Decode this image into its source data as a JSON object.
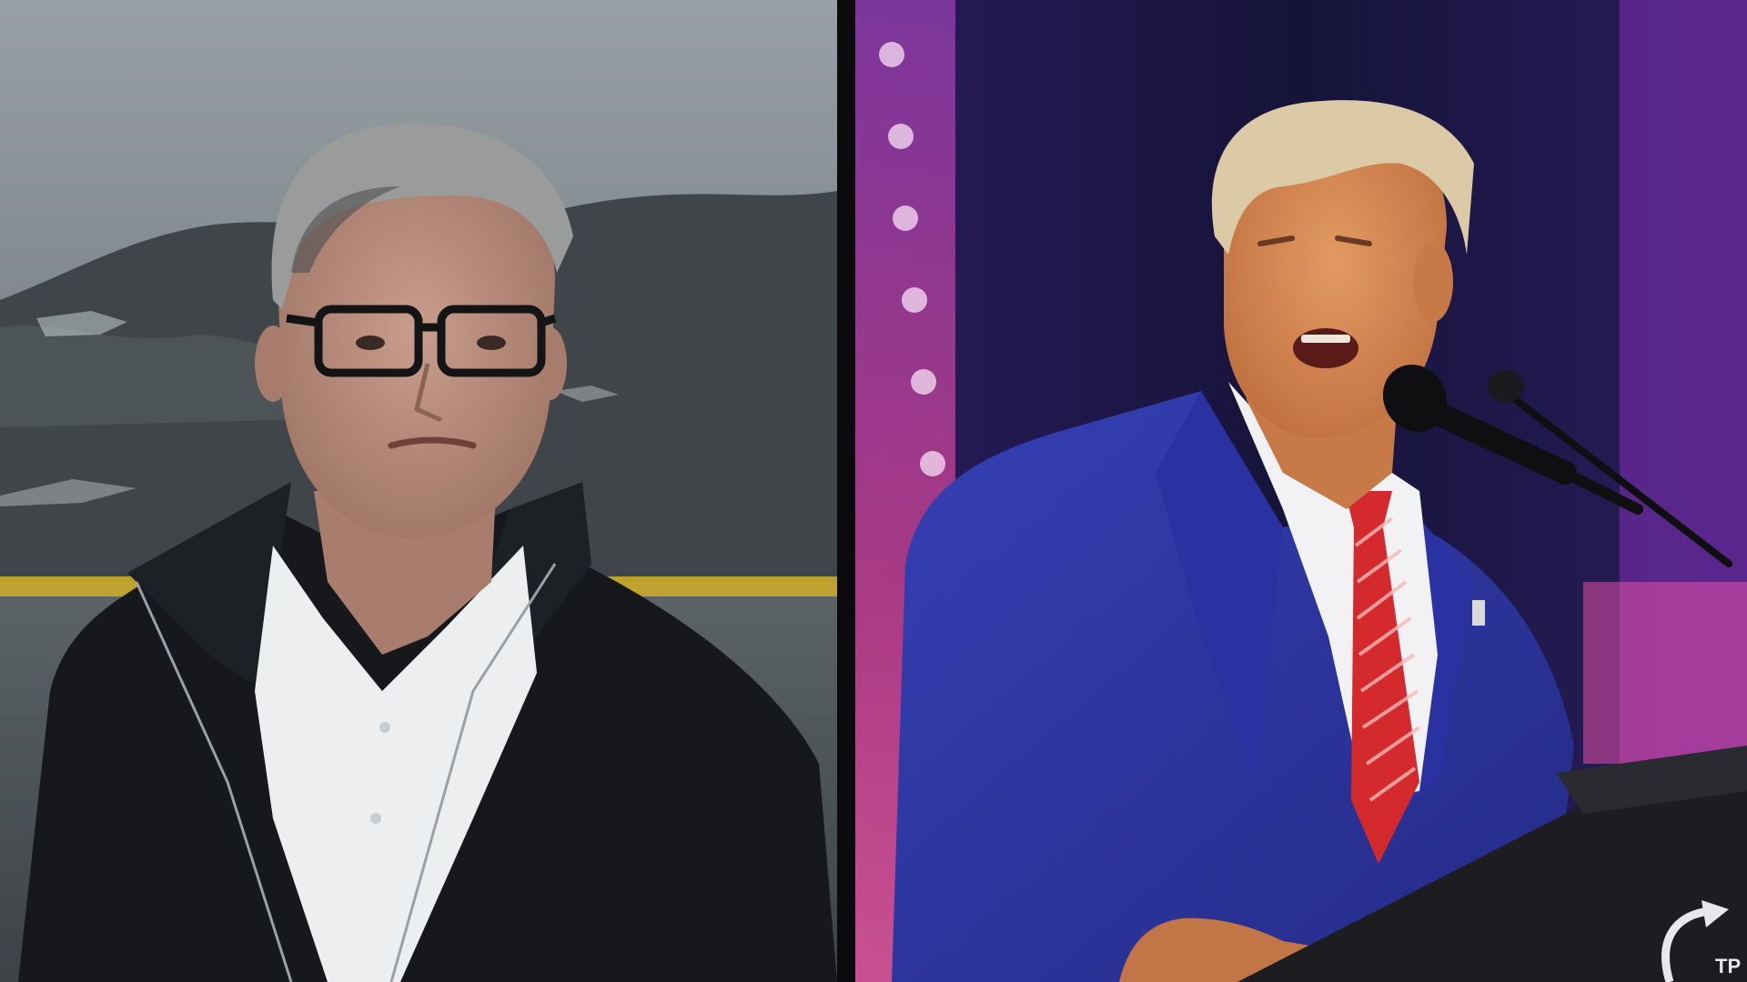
{
  "colors": {
    "divider": "#0b0b0d",
    "left_sky": "#8f979c",
    "left_hills": "#3d4346",
    "left_water": "#525a5e",
    "left_buoy_line": "#d2b12a",
    "jacket": "#15171a",
    "shirt": "#eef0f2",
    "skin_left": "#b88f80",
    "hair_grey": "#9a9c9c",
    "glasses": "#141414",
    "right_bg": "#1b1846",
    "stage_light_left": "#a23a9a",
    "stage_light_right": "#7a2aa0",
    "suit_blue": "#2b33a0",
    "tie_red": "#d42a2e",
    "skin_right": "#d98a55",
    "hair_blond": "#dcc9a6",
    "podium": "#1c1c20",
    "microphone": "#0e0e10"
  },
  "podium_logo_text": "TP"
}
